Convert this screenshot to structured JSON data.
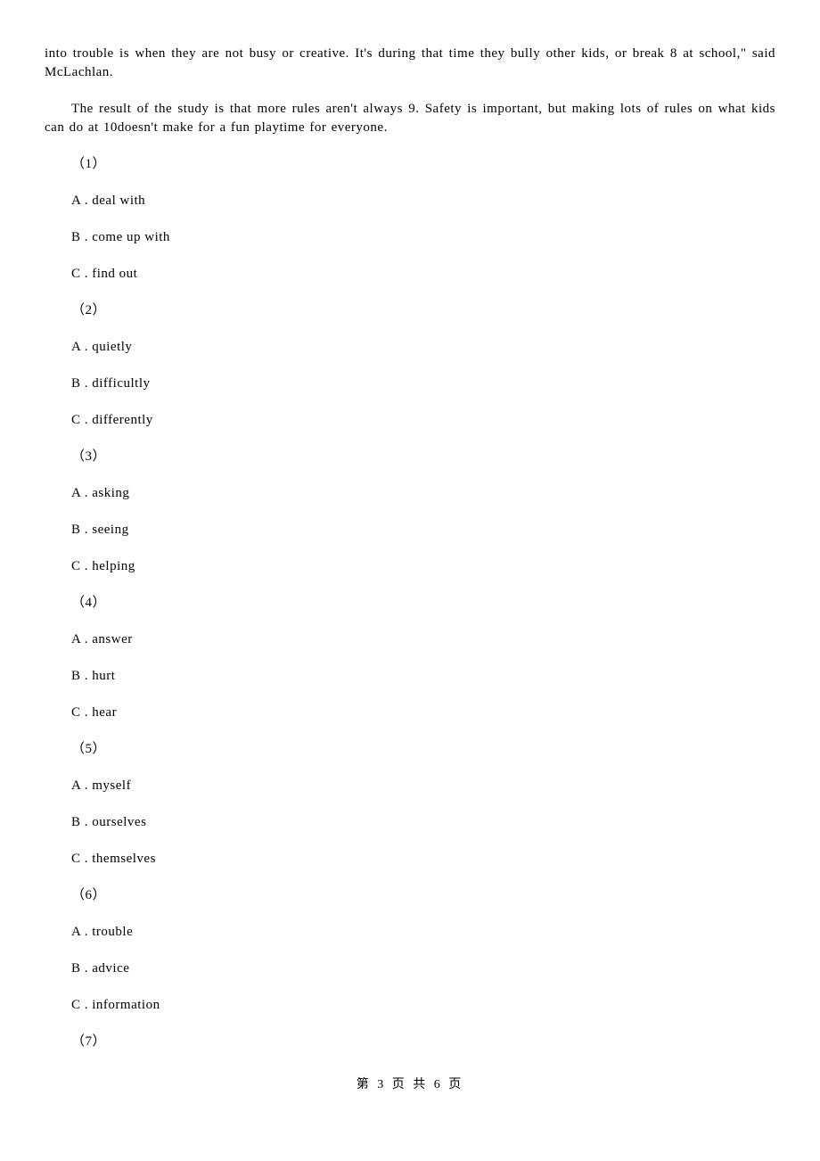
{
  "paragraphs": {
    "p1": "into trouble is when they are not busy or creative. It's during that time they bully other kids, or break 8 at school,\" said McLachlan.",
    "p2": "The result of the study is that more rules aren't always 9. Safety is important, but making lots of rules on what kids can do at 10doesn't make for a fun playtime for everyone."
  },
  "questions": [
    {
      "num": "（1）",
      "options": [
        {
          "label": "A . ",
          "text": "deal with"
        },
        {
          "label": "B . ",
          "text": "come up with"
        },
        {
          "label": "C . ",
          "text": "find out"
        }
      ]
    },
    {
      "num": "（2）",
      "options": [
        {
          "label": "A . ",
          "text": "quietly"
        },
        {
          "label": "B . ",
          "text": "difficultly"
        },
        {
          "label": "C . ",
          "text": "differently"
        }
      ]
    },
    {
      "num": "（3）",
      "options": [
        {
          "label": "A . ",
          "text": "asking"
        },
        {
          "label": "B . ",
          "text": "seeing"
        },
        {
          "label": "C . ",
          "text": "helping"
        }
      ]
    },
    {
      "num": "（4）",
      "options": [
        {
          "label": "A . ",
          "text": "answer"
        },
        {
          "label": "B . ",
          "text": "hurt"
        },
        {
          "label": "C . ",
          "text": "hear"
        }
      ]
    },
    {
      "num": "（5）",
      "options": [
        {
          "label": "A . ",
          "text": "myself"
        },
        {
          "label": "B . ",
          "text": "ourselves"
        },
        {
          "label": "C . ",
          "text": "themselves"
        }
      ]
    },
    {
      "num": "（6）",
      "options": [
        {
          "label": "A . ",
          "text": "trouble"
        },
        {
          "label": "B . ",
          "text": "advice"
        },
        {
          "label": "C . ",
          "text": "information"
        }
      ]
    },
    {
      "num": "（7）",
      "options": []
    }
  ],
  "footer": "第 3 页 共 6 页"
}
